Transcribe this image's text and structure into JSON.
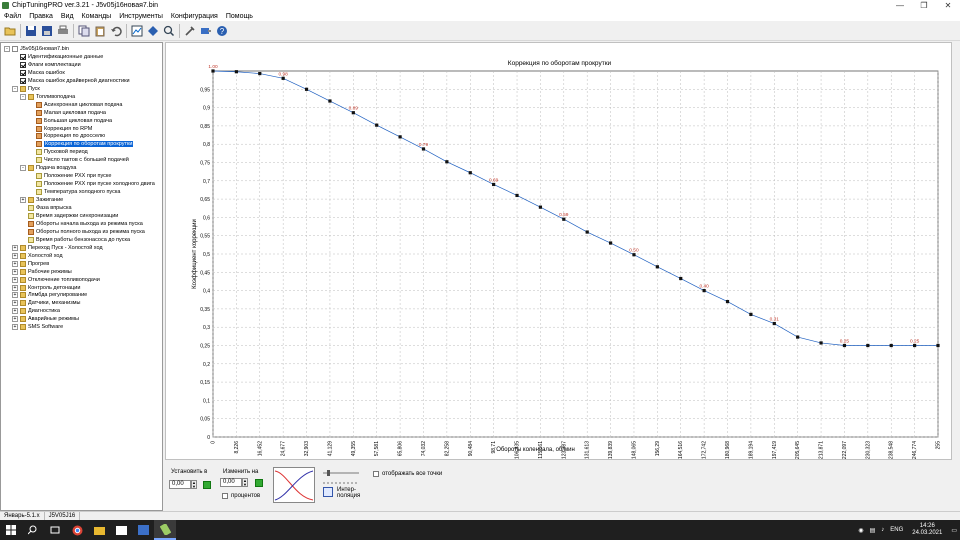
{
  "window": {
    "title": "ChipTuningPRO ver.3.21 - J5v05j16новая7.bin",
    "controls": {
      "minimize": "—",
      "maximize": "❐",
      "close": "✕"
    }
  },
  "menu": [
    "Файл",
    "Правка",
    "Вид",
    "Команды",
    "Инструменты",
    "Конфигурация",
    "Помощь"
  ],
  "toolbar": {
    "icons": [
      "open-icon",
      "save-icon",
      "save-as-icon",
      "print-icon",
      "copy-icon",
      "paste-icon",
      "undo-icon",
      "compare-icon",
      "diamond-icon",
      "search-icon",
      "tools-icon",
      "connect-icon",
      "help-icon"
    ]
  },
  "tree": [
    {
      "label": "J5v05j16новая7.bin",
      "level": 0,
      "icon": "doc",
      "exp": "-"
    },
    {
      "label": "Идентификационные данные",
      "level": 1,
      "icon": "chk"
    },
    {
      "label": "Флаги комплектации",
      "level": 1,
      "icon": "chk"
    },
    {
      "label": "Маска ошибок",
      "level": 1,
      "icon": "chk"
    },
    {
      "label": "Маска ошибок драйверной диагностики",
      "level": 1,
      "icon": "chk"
    },
    {
      "label": "Пуск",
      "level": 1,
      "icon": "fold",
      "exp": "-"
    },
    {
      "label": "Топливоподача",
      "level": 2,
      "icon": "fold",
      "exp": "-"
    },
    {
      "label": "Асинхронная цикловая подача",
      "level": 3,
      "icon": "map"
    },
    {
      "label": "Малая цикловая подача",
      "level": 3,
      "icon": "map"
    },
    {
      "label": "Большая цикловая подача",
      "level": 3,
      "icon": "map"
    },
    {
      "label": "Коррекция по RPM",
      "level": 3,
      "icon": "map"
    },
    {
      "label": "Коррекция по дросселю",
      "level": 3,
      "icon": "map"
    },
    {
      "label": "Коррекция по оборотам прокрутки",
      "level": 3,
      "icon": "map",
      "selected": true
    },
    {
      "label": "Пусковой период",
      "level": 3,
      "icon": "tbl"
    },
    {
      "label": "Число тактов с большей подачей",
      "level": 3,
      "icon": "tbl"
    },
    {
      "label": "Подача воздуха",
      "level": 2,
      "icon": "fold",
      "exp": "-"
    },
    {
      "label": "Положение РХХ при пуске",
      "level": 3,
      "icon": "tbl"
    },
    {
      "label": "Положение РХХ при пуске холодного двига",
      "level": 3,
      "icon": "tbl"
    },
    {
      "label": "Температура холодного пуска",
      "level": 3,
      "icon": "tbl"
    },
    {
      "label": "Зажигание",
      "level": 2,
      "icon": "fold",
      "exp": "+"
    },
    {
      "label": "Фаза впрыска",
      "level": 2,
      "icon": "tbl"
    },
    {
      "label": "Время задержки синхронизации",
      "level": 2,
      "icon": "tbl"
    },
    {
      "label": "Обороты начала выхода из режима пуска",
      "level": 2,
      "icon": "map"
    },
    {
      "label": "Обороты полного выхода из режима пуска",
      "level": 2,
      "icon": "map"
    },
    {
      "label": "Время работы бензонасоса до пуска",
      "level": 2,
      "icon": "tbl"
    },
    {
      "label": "Переход Пуск - Холостой ход",
      "level": 1,
      "icon": "fold",
      "exp": "+"
    },
    {
      "label": "Холостой ход",
      "level": 1,
      "icon": "fold",
      "exp": "+"
    },
    {
      "label": "Прогрев",
      "level": 1,
      "icon": "fold",
      "exp": "+"
    },
    {
      "label": "Рабочие режимы",
      "level": 1,
      "icon": "fold",
      "exp": "+"
    },
    {
      "label": "Отключение топливоподачи",
      "level": 1,
      "icon": "fold",
      "exp": "+"
    },
    {
      "label": "Контроль детонации",
      "level": 1,
      "icon": "fold",
      "exp": "+"
    },
    {
      "label": "Лямбда регулирование",
      "level": 1,
      "icon": "fold",
      "exp": "+"
    },
    {
      "label": "Датчики, механизмы",
      "level": 1,
      "icon": "fold",
      "exp": "+"
    },
    {
      "label": "Диагностика",
      "level": 1,
      "icon": "fold",
      "exp": "+"
    },
    {
      "label": "Аварийные режимы",
      "level": 1,
      "icon": "fold",
      "exp": "+"
    },
    {
      "label": "SMS Software",
      "level": 1,
      "icon": "fold",
      "exp": "+"
    }
  ],
  "chart_data": {
    "type": "line",
    "title": "Коррекция по оборотам прокрутки",
    "xlabel": "Обороты коленвала, об/мин",
    "ylabel": "Коэффициент коррекции",
    "x_ticks": [
      "0",
      "8,226",
      "16,452",
      "24,677",
      "32,903",
      "41,129",
      "49,355",
      "57,581",
      "65,806",
      "74,032",
      "82,258",
      "90,484",
      "98,71",
      "106,935",
      "115,161",
      "123,387",
      "131,613",
      "139,839",
      "148,065",
      "156,29",
      "164,516",
      "172,742",
      "180,968",
      "189,194",
      "197,419",
      "205,645",
      "213,871",
      "222,097",
      "230,323",
      "238,548",
      "246,774",
      "255"
    ],
    "y_ticks": [
      "0",
      "0,05",
      "0,1",
      "0,15",
      "0,2",
      "0,25",
      "0,3",
      "0,35",
      "0,4",
      "0,45",
      "0,5",
      "0,55",
      "0,6",
      "0,65",
      "0,7",
      "0,75",
      "0,8",
      "0,85",
      "0,9",
      "0,95"
    ],
    "ylim": [
      0,
      1.0
    ],
    "values": [
      1.0,
      0.998,
      0.993,
      0.98,
      0.95,
      0.918,
      0.886,
      0.852,
      0.82,
      0.787,
      0.752,
      0.722,
      0.69,
      0.66,
      0.628,
      0.595,
      0.56,
      0.53,
      0.498,
      0.465,
      0.433,
      0.4,
      0.37,
      0.335,
      0.31,
      0.273,
      0.257,
      0.25,
      0.25,
      0.25,
      0.25,
      0.25
    ],
    "point_labels": {
      "0": "1.00",
      "3": "0.98",
      "6": "0.89",
      "9": "0.79",
      "12": "0.69",
      "15": "0.59",
      "18": "0.50",
      "21": "0.40",
      "24": "0.31",
      "27": "0.25",
      "30": "0.25"
    },
    "grid": true
  },
  "bottom": {
    "set_to_label": "Установить в",
    "set_to_value": "0,00",
    "change_by_label": "Изменить на",
    "change_by_value": "0,00",
    "percent_label": "процентов",
    "interp_label": "Интер-\nполяция",
    "show_all_label": "отображать все точки"
  },
  "status": {
    "left": "Январь-5.1.x",
    "mid": "J5V05J16"
  },
  "tray": {
    "lang": "ENG",
    "time": "14:26",
    "date": "24.03.2021"
  }
}
